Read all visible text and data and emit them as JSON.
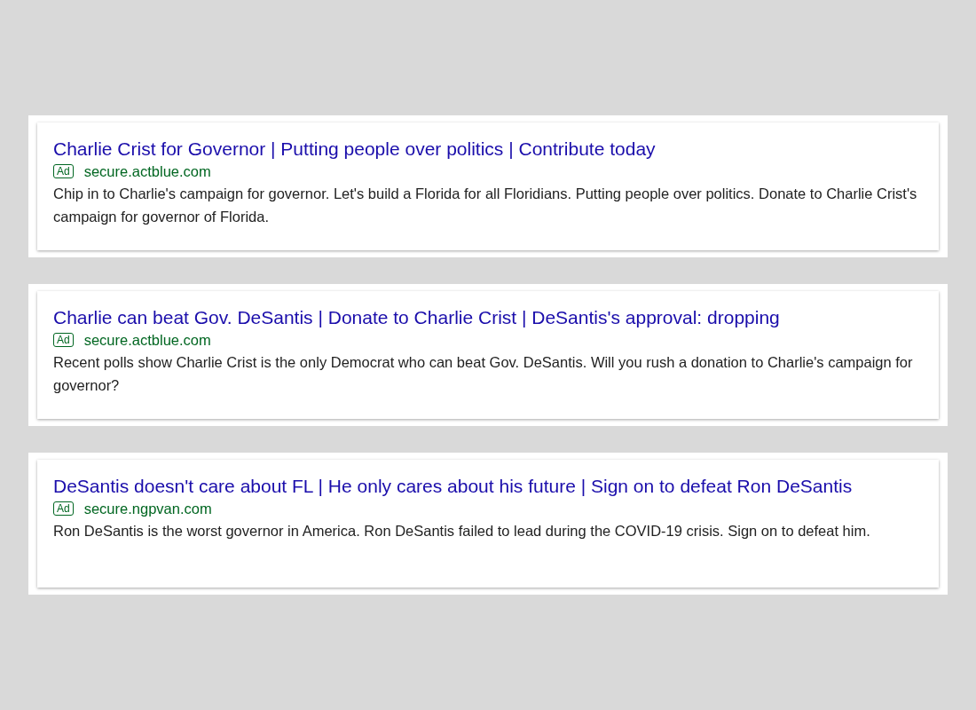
{
  "ads": [
    {
      "title": "Charlie Crist for Governor | Putting people over politics | Contribute today",
      "badge": "Ad",
      "url": "secure.actblue.com",
      "description": "Chip in to Charlie's campaign for governor. Let's build a Florida for all Floridians. Putting people over politics. Donate to Charlie Crist's campaign for governor of Florida."
    },
    {
      "title": "Charlie can beat Gov. DeSantis | Donate to Charlie Crist | DeSantis's approval: dropping",
      "badge": "Ad",
      "url": "secure.actblue.com",
      "description": "Recent polls show Charlie Crist is the only Democrat who can beat Gov. DeSantis. Will you rush a donation to Charlie's campaign for governor?"
    },
    {
      "title": "DeSantis doesn't care about FL | He only cares about his future | Sign on to defeat Ron DeSantis",
      "badge": "Ad",
      "url": "secure.ngpvan.com",
      "description": "Ron DeSantis is the worst governor in America. Ron DeSantis failed to lead during the COVID-19 crisis. Sign on to defeat him."
    }
  ]
}
